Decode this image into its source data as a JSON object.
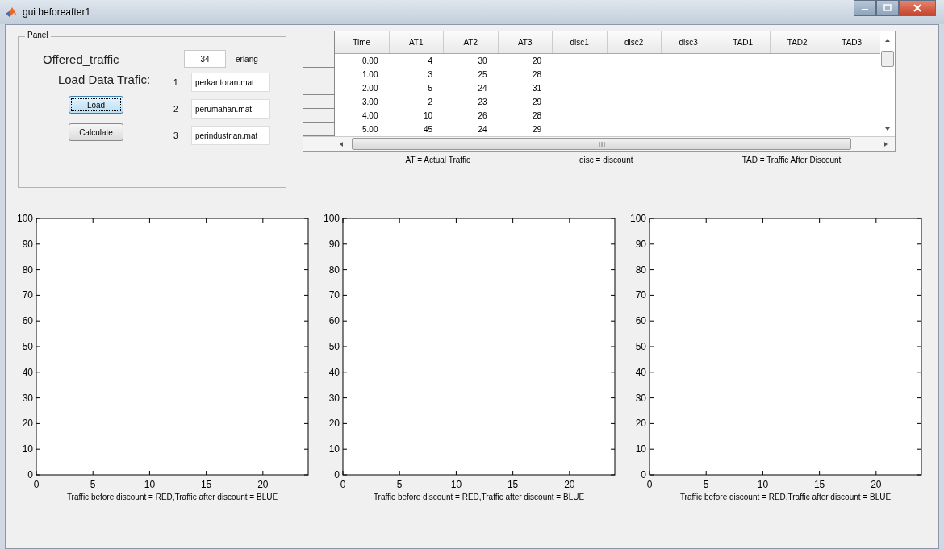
{
  "window": {
    "title": "gui beforeafter1"
  },
  "panel": {
    "title": "Panel",
    "offered_label": "Offered_traffic",
    "offered_value": "34",
    "offered_unit": "erlang",
    "load_label": "Load Data Trafic:",
    "files": [
      {
        "number": "1",
        "value": "perkantoran.mat"
      },
      {
        "number": "2",
        "value": "perumahan.mat"
      },
      {
        "number": "3",
        "value": "perindustrian.mat"
      }
    ],
    "buttons": [
      {
        "label": "Load",
        "focused": true
      },
      {
        "label": "Calculate",
        "focused": false
      }
    ]
  },
  "table": {
    "columns": [
      "Time",
      "AT1",
      "AT2",
      "AT3",
      "disc1",
      "disc2",
      "disc3",
      "TAD1",
      "TAD2",
      "TAD3"
    ],
    "rows": [
      [
        "0.00",
        "4",
        "30",
        "20"
      ],
      [
        "1.00",
        "3",
        "25",
        "28"
      ],
      [
        "2.00",
        "5",
        "24",
        "31"
      ],
      [
        "3.00",
        "2",
        "23",
        "29"
      ],
      [
        "4.00",
        "10",
        "26",
        "28"
      ],
      [
        "5.00",
        "45",
        "24",
        "29"
      ]
    ]
  },
  "legend_notes": [
    "AT = Actual Traffic",
    "disc = discount",
    "TAD = Traffic After Discount"
  ],
  "axes": [
    {
      "chart_data": {
        "type": "line",
        "xlabel": "Traffic before discount = RED,Traffic after discount = BLUE",
        "xlim": [
          0,
          24
        ],
        "ylim": [
          0,
          100
        ],
        "xticks": [
          0,
          5,
          10,
          15,
          20
        ],
        "yticks": [
          0,
          10,
          20,
          30,
          40,
          50,
          60,
          70,
          80,
          90,
          100
        ]
      }
    },
    {
      "chart_data": {
        "type": "line",
        "xlabel": "Traffic before discount = RED,Traffic after discount = BLUE",
        "xlim": [
          0,
          24
        ],
        "ylim": [
          0,
          100
        ],
        "xticks": [
          0,
          5,
          10,
          15,
          20
        ],
        "yticks": [
          0,
          10,
          20,
          30,
          40,
          50,
          60,
          70,
          80,
          90,
          100
        ]
      }
    },
    {
      "chart_data": {
        "type": "line",
        "xlabel": "Traffic before discount = RED,Traffic after discount = BLUE",
        "xlim": [
          0,
          24
        ],
        "ylim": [
          0,
          100
        ],
        "xticks": [
          0,
          5,
          10,
          15,
          20
        ],
        "yticks": [
          0,
          10,
          20,
          30,
          40,
          50,
          60,
          70,
          80,
          90,
          100
        ]
      }
    }
  ]
}
